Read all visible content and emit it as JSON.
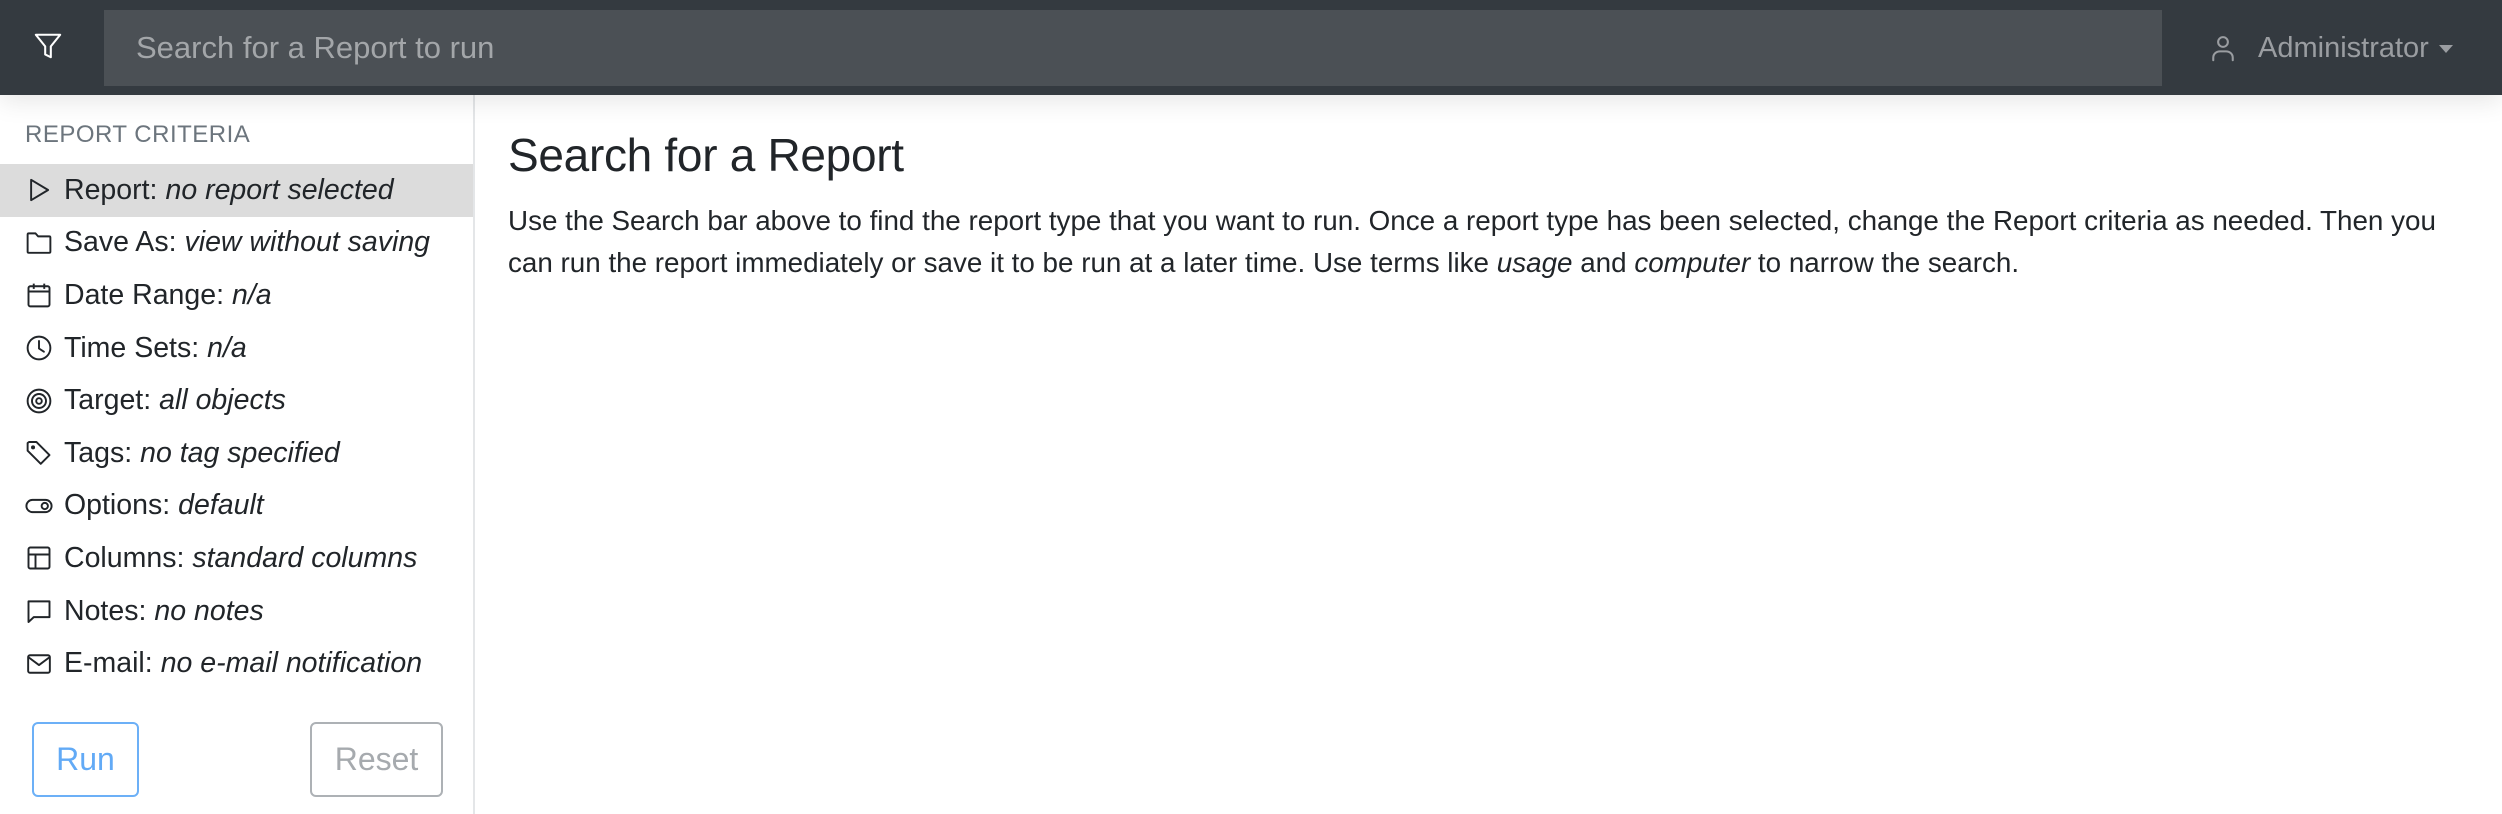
{
  "topbar": {
    "filter_icon": "filter-funnel-icon",
    "search_placeholder": "Search for a Report to run",
    "search_value": "",
    "user_icon": "user-person-icon",
    "user_name": "Administrator",
    "user_caret_icon": "caret-down-icon"
  },
  "sidebar": {
    "title": "REPORT CRITERIA",
    "items": [
      {
        "icon": "play-triangle-icon",
        "label": "Report:",
        "value": "no report selected",
        "active": true
      },
      {
        "icon": "folder-icon",
        "label": "Save As:",
        "value": "view without saving",
        "active": false
      },
      {
        "icon": "calendar-icon",
        "label": "Date Range:",
        "value": "n/a",
        "active": false
      },
      {
        "icon": "clock-icon",
        "label": "Time Sets:",
        "value": "n/a",
        "active": false
      },
      {
        "icon": "target-icon",
        "label": "Target:",
        "value": "all objects",
        "active": false
      },
      {
        "icon": "tag-icon",
        "label": "Tags:",
        "value": "no tag specified",
        "active": false
      },
      {
        "icon": "toggle-icon",
        "label": "Options:",
        "value": "default",
        "active": false
      },
      {
        "icon": "layout-columns-icon",
        "label": "Columns:",
        "value": "standard columns",
        "active": false
      },
      {
        "icon": "chat-bubble-icon",
        "label": "Notes:",
        "value": "no notes",
        "active": false
      },
      {
        "icon": "envelope-icon",
        "label": "E-mail:",
        "value": "no e-mail notification",
        "active": false
      }
    ],
    "run_label": "Run",
    "reset_label": "Reset"
  },
  "main": {
    "heading": "Search for a Report",
    "paragraph": {
      "part1": "Use the Search bar above to find the report type that you want to run. Once a report type has been selected, change the Report criteria as needed. Then you can run the report immediately or save it to be run at a later time. Use terms like ",
      "em1": "usage",
      "part2": " and ",
      "em2": "computer",
      "part3": " to narrow the search."
    }
  },
  "colors": {
    "topbar_bg": "#343a40",
    "search_bg": "#4b5055",
    "active_row_bg": "#dcdcdc",
    "run_accent": "#62aaf6",
    "reset_gray": "#a6aaae"
  }
}
